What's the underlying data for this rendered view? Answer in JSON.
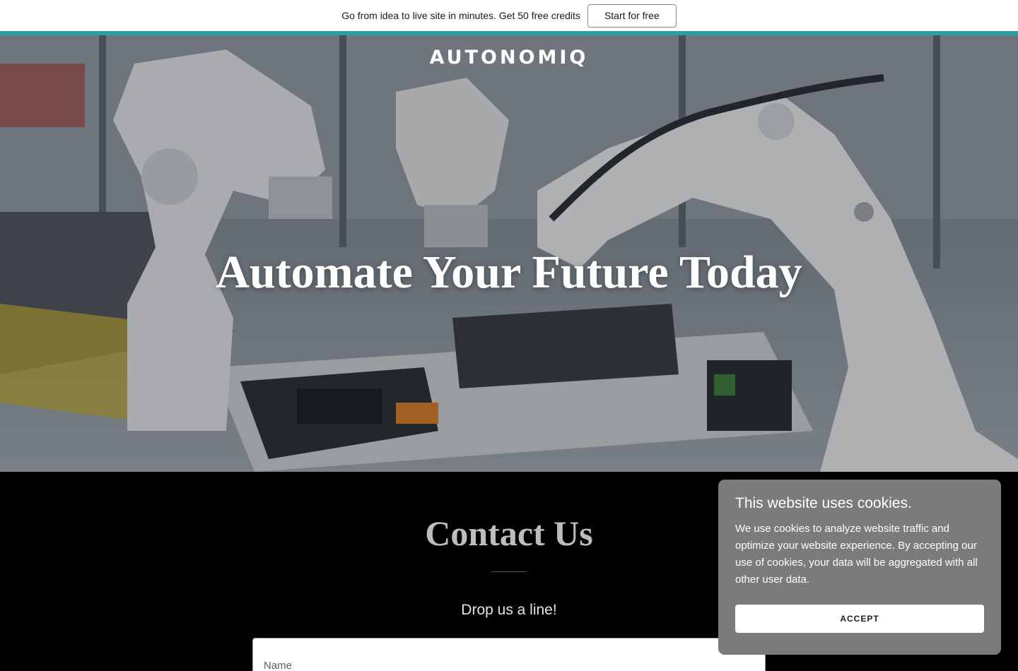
{
  "promo": {
    "text": "Go from idea to live site in minutes. Get 50 free credits",
    "button_label": "Start for free"
  },
  "colors": {
    "accent": "#2a9fa6",
    "section_background": "#000000",
    "cookie_background": "#7b7b7b"
  },
  "hero": {
    "logo_text": "AUTONOMIQ",
    "title": "Automate Your Future Today",
    "background_image": "robotic-arms-factory-photo"
  },
  "contact": {
    "title": "Contact Us",
    "subtitle": "Drop us a line!",
    "name_placeholder": "Name"
  },
  "cookie_banner": {
    "title": "This website uses cookies.",
    "body": "We use cookies to analyze website traffic and optimize your website experience. By accepting our use of cookies, your data will be aggregated with all other user data.",
    "accept_label": "ACCEPT"
  }
}
